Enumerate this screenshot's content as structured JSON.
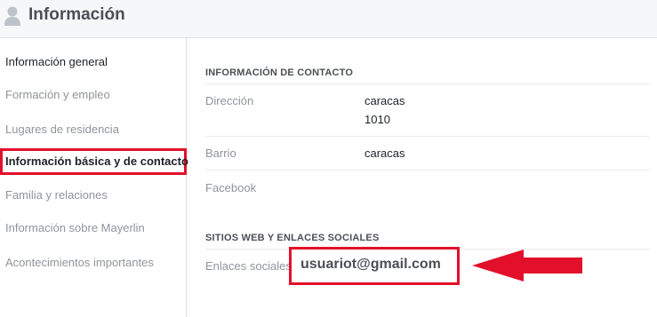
{
  "header": {
    "title": "Información",
    "icon": "person-icon"
  },
  "sidebar": {
    "items": [
      {
        "label": "Información general"
      },
      {
        "label": "Formación y empleo"
      },
      {
        "label": "Lugares de residencia"
      },
      {
        "label": "Información básica y de contacto"
      },
      {
        "label": "Familia y relaciones"
      },
      {
        "label": "Información sobre Mayerlin"
      },
      {
        "label": "Acontecimientos importantes"
      }
    ]
  },
  "contact": {
    "section_title": "INFORMACIÓN DE CONTACTO",
    "address_label": "Dirección",
    "address_line1": "caracas",
    "address_line2": "1010",
    "neighborhood_label": "Barrio",
    "neighborhood_value": "caracas",
    "facebook_label": "Facebook"
  },
  "web": {
    "section_title": "SITIOS WEB Y ENLACES SOCIALES",
    "social_label": "Enlaces sociales",
    "email": "usuariot@gmail.com"
  },
  "colors": {
    "highlight": "#e2102a",
    "muted_text": "#90949c",
    "header_bg": "#f6f7f9"
  }
}
